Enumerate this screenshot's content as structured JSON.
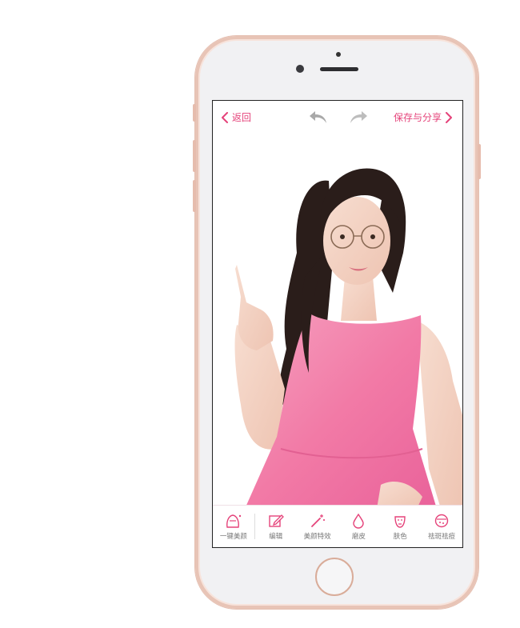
{
  "header": {
    "back_label": "返回",
    "save_label": "保存与分享"
  },
  "toolbar": {
    "items": [
      {
        "label": "一键美颜",
        "icon": "face-magic-icon"
      },
      {
        "label": "编辑",
        "icon": "edit-icon"
      },
      {
        "label": "美颜特效",
        "icon": "magic-wand-icon"
      },
      {
        "label": "磨皮",
        "icon": "drop-icon"
      },
      {
        "label": "肤色",
        "icon": "face-mask-icon"
      },
      {
        "label": "祛斑祛痘",
        "icon": "spot-remove-icon"
      }
    ]
  },
  "colors": {
    "accent": "#e5437a",
    "phone_frame": "#e8c4b6",
    "dress": "#f27aa6",
    "hair": "#2a1d1a"
  }
}
